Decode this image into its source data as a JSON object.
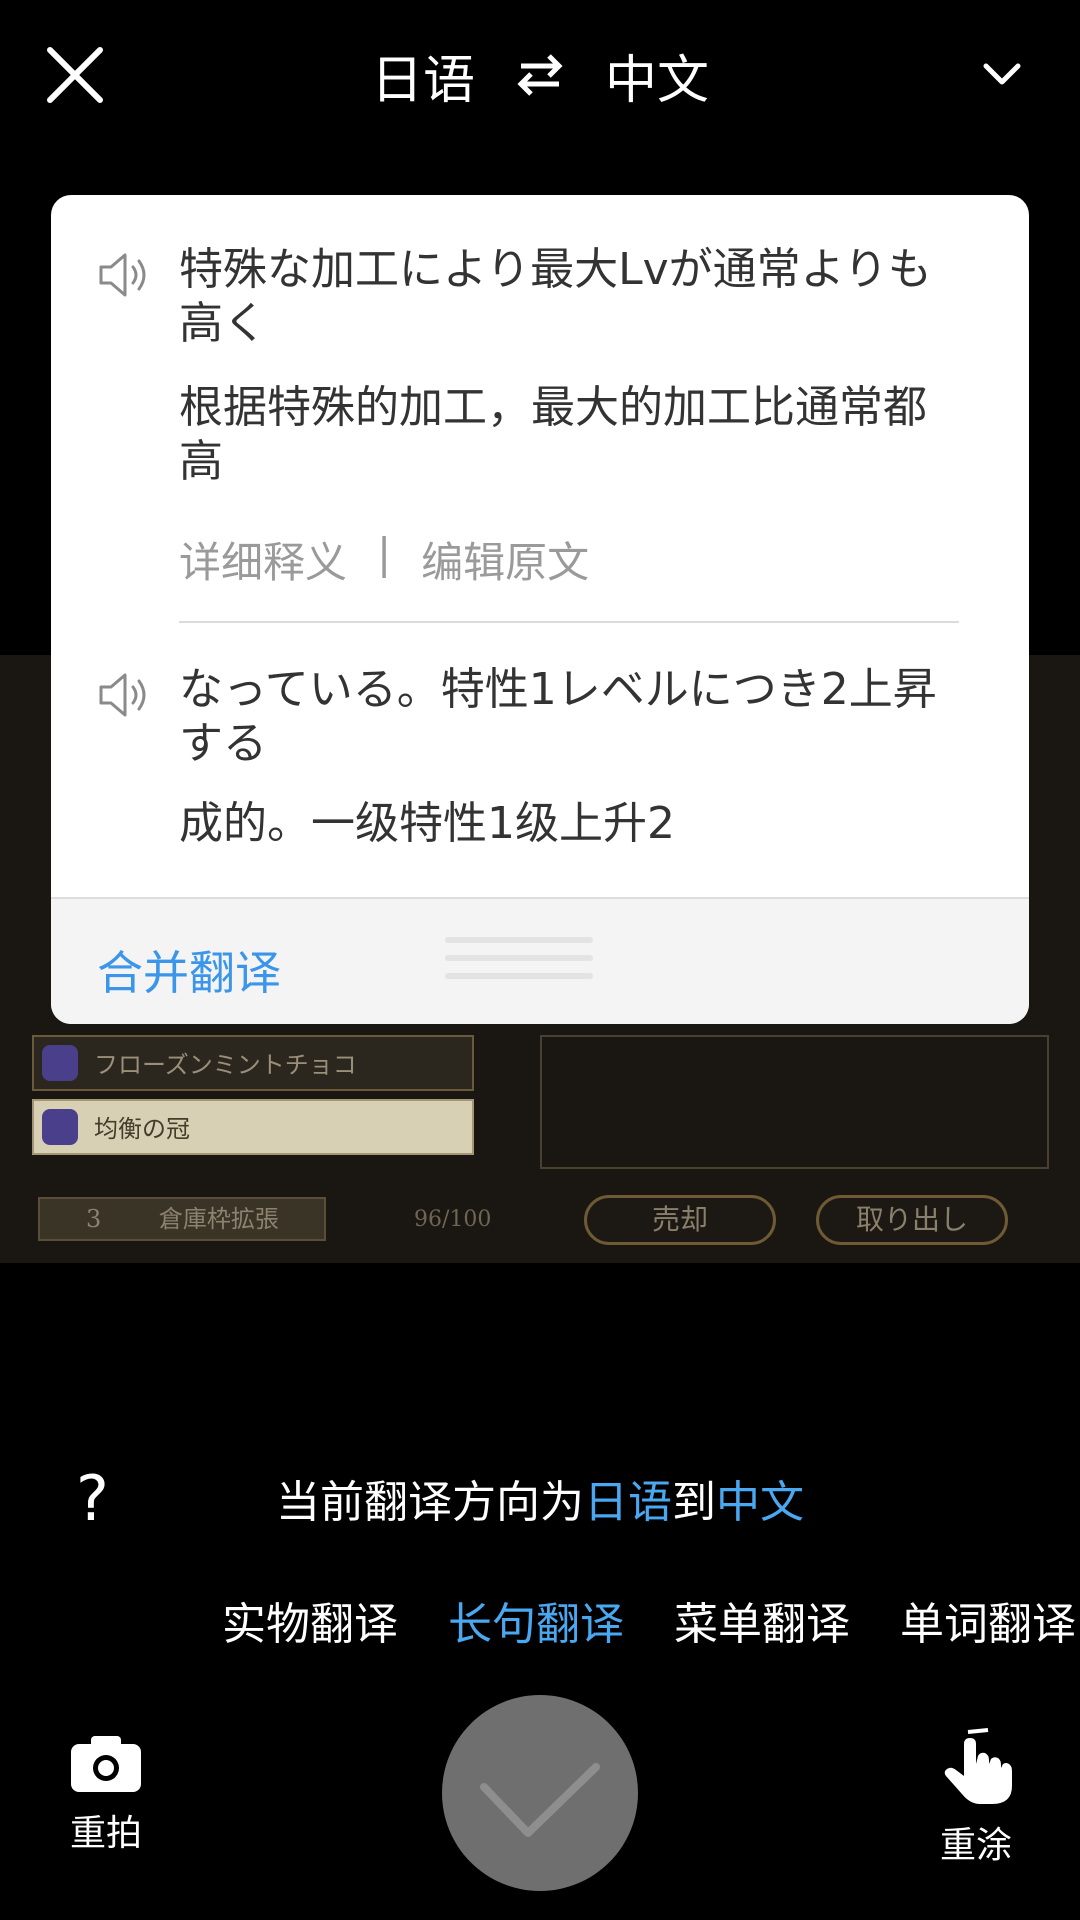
{
  "header": {
    "source_lang": "日语",
    "target_lang": "中文"
  },
  "results": [
    {
      "original": "特殊な加工により最大Lvが通常よりも高く",
      "translation": "根据特殊的加工，最大的加工比通常都高"
    },
    {
      "original": "なっている。特性1レベルにつき2上昇する",
      "translation": "成的。一级特性1级上升2"
    }
  ],
  "links": {
    "detail": "详细释义",
    "separator": "|",
    "edit": "编辑原文"
  },
  "card_footer": {
    "merge_label": "合并翻译"
  },
  "direction": {
    "prefix": "当前翻译方向为",
    "from": "日语",
    "middle": "到",
    "to": "中文"
  },
  "modes": [
    "实物翻译",
    "长句翻译",
    "菜单翻译",
    "单词翻译"
  ],
  "active_mode": "长句翻译",
  "actions": {
    "retake_label": "重拍",
    "repaint_label": "重涂"
  },
  "background_game": {
    "items": [
      "フローズンミントチョコ",
      "均衡の冠"
    ],
    "footer_count": "3",
    "footer_label": "倉庫枠拡張",
    "capacity": "96/100",
    "sell_label": "売却",
    "takeout_label": "取り出し"
  },
  "colors": {
    "accent": "#4aa8f0",
    "merge_blue": "#3b95e8",
    "confirm_gray": "#6f6f6f"
  }
}
